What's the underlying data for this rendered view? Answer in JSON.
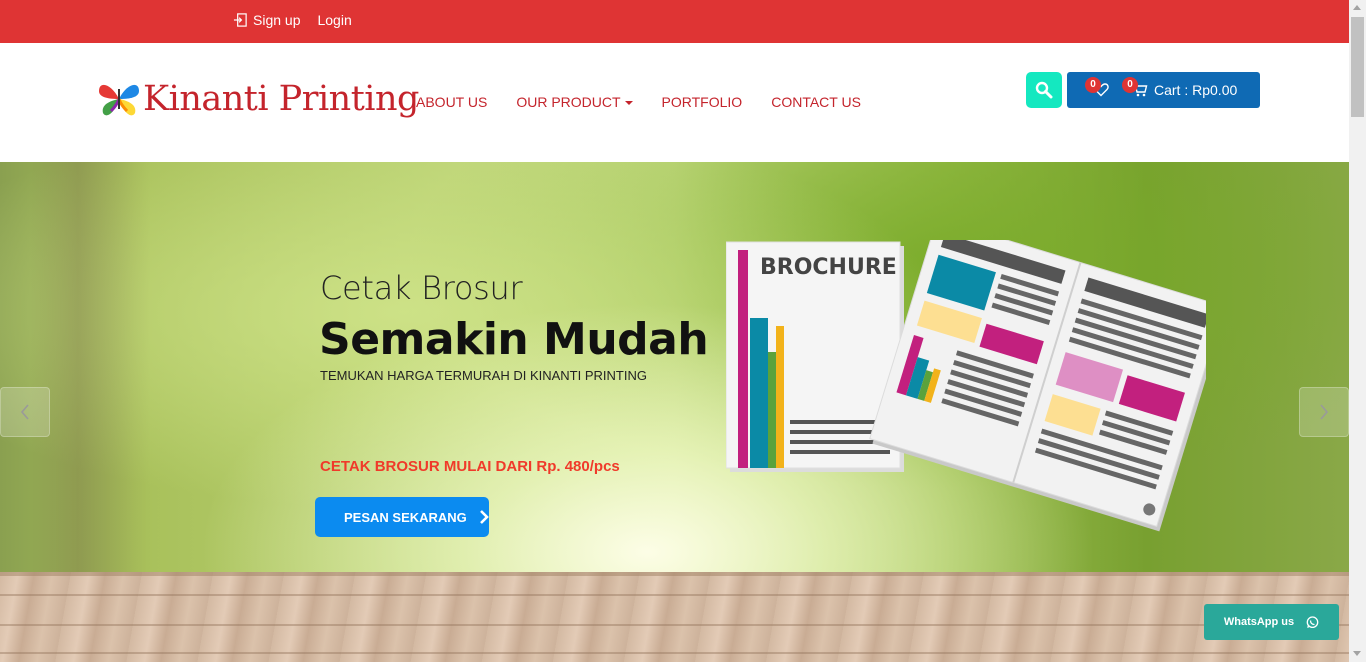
{
  "topbar": {
    "signup_label": "Sign up",
    "login_label": "Login"
  },
  "header": {
    "brand": "Kinanti Printing",
    "nav": [
      {
        "label": "ABOUT US"
      },
      {
        "label": "OUR PRODUCT"
      },
      {
        "label": "PORTFOLIO"
      },
      {
        "label": "CONTACT US"
      }
    ],
    "wishlist_count": "0",
    "cart_count": "0",
    "cart_label": "Cart : Rp0.00",
    "colors": {
      "topbar": "#df3434",
      "nav_text": "#c4242c",
      "search_button": "#14e8c0",
      "cart_button": "#0f6ab4"
    }
  },
  "hero": {
    "title_small": "Cetak Brosur",
    "title_big": "Semakin Mudah",
    "subtitle": "TEMUKAN HARGA TERMURAH DI KINANTI PRINTING",
    "price_text": "CETAK BROSUR MULAI DARI Rp. 480/pcs",
    "cta_label": "PESAN SEKARANG",
    "illustration_label": "BROCHURE",
    "prev_icon": "chevron-left-icon",
    "next_icon": "chevron-right-icon"
  },
  "whatsapp": {
    "label": "WhatsApp us",
    "icon": "whatsapp-icon"
  }
}
